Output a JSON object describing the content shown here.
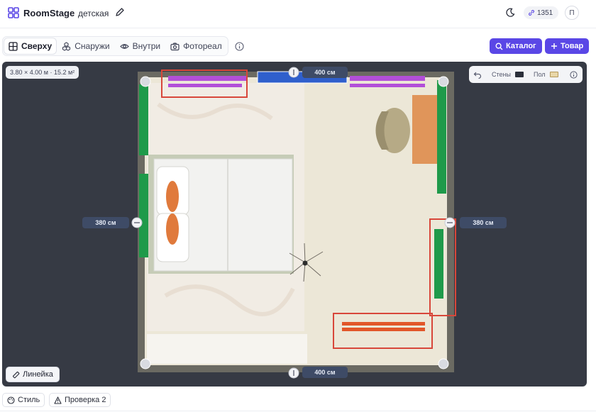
{
  "header": {
    "brand": "RoomStage",
    "room_name": "детская",
    "points": "1351",
    "avatar_initial": "П"
  },
  "toolbar": {
    "tabs": [
      {
        "label": "Сверху",
        "icon": "grid-icon",
        "active": true
      },
      {
        "label": "Снаружи",
        "icon": "cubes-icon",
        "active": false
      },
      {
        "label": "Внутри",
        "icon": "eye-icon",
        "active": false
      },
      {
        "label": "Фотореал",
        "icon": "camera-icon",
        "active": false
      }
    ],
    "catalog_label": "Каталог",
    "add_label": "Товар"
  },
  "canvas": {
    "area": "3.80 × 4.00 м · 15.2 м²",
    "dims": {
      "top": "400 см",
      "bottom": "400 см",
      "left": "380 см",
      "right": "380 см"
    },
    "legend": {
      "walls_label": "Стены",
      "floor_label": "Пол",
      "walls_color": "#2b2f3a",
      "floor_color": "#e9d7a8"
    },
    "ruler_label": "Линейка"
  },
  "bottom": {
    "style_label": "Стиль",
    "check_label": "Проверка 2"
  },
  "colors": {
    "accent": "#5a47e6",
    "highlight": "#d8473a",
    "wall": "#6b6a62",
    "floor": "#ece7d7",
    "window": "#1f9a4a",
    "door": "#2f5fcc",
    "shelf": "#b24fd8",
    "radiator": "#e2572a"
  }
}
